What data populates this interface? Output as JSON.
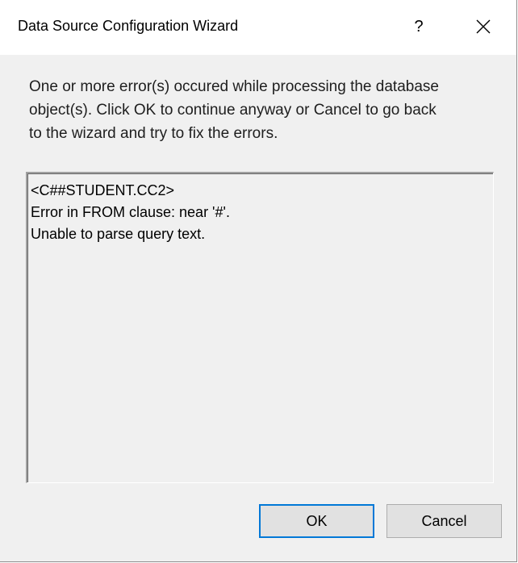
{
  "window": {
    "title": "Data Source Configuration Wizard",
    "help_label": "?",
    "close_label": "close"
  },
  "message": {
    "lines": [
      "One or more error(s) occured while processing the database",
      "object(s). Click OK to continue anyway or Cancel to go back",
      "to the wizard and try to fix the errors."
    ]
  },
  "errors": {
    "lines": [
      "<C##STUDENT.CC2>",
      "Error in FROM clause: near '#'.",
      "Unable to parse query text."
    ]
  },
  "buttons": {
    "ok_label": "OK",
    "cancel_label": "Cancel"
  },
  "colors": {
    "dialog_background": "#f0f0f0",
    "titlebar_background": "#ffffff",
    "default_button_border": "#0078d7",
    "button_face": "#e1e1e1"
  },
  "icons": {
    "help": "question-mark-icon",
    "close": "close-icon"
  }
}
